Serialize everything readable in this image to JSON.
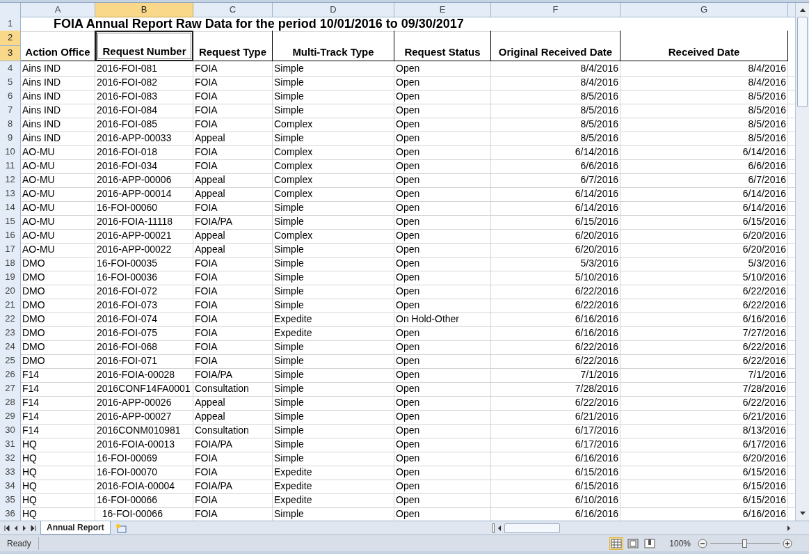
{
  "columns": [
    {
      "label": "A",
      "selected": false
    },
    {
      "label": "B",
      "selected": true
    },
    {
      "label": "C",
      "selected": false
    },
    {
      "label": "D",
      "selected": false
    },
    {
      "label": "E",
      "selected": false
    },
    {
      "label": "F",
      "selected": false
    },
    {
      "label": "G",
      "selected": false
    }
  ],
  "title_row": {
    "row": "1",
    "selected": false,
    "text": "FOIA Annual Report Raw Data for the period 10/01/2016 to 09/30/2017"
  },
  "header_rows": [
    {
      "row": "2",
      "selected": true
    },
    {
      "row": "3",
      "selected": true
    }
  ],
  "headers": [
    {
      "text": "Action Office",
      "selected": false
    },
    {
      "text": "Request Number",
      "selected": true
    },
    {
      "text": "Request Type",
      "selected": false
    },
    {
      "text": "Multi-Track Type",
      "selected": false
    },
    {
      "text": "Request Status",
      "selected": false
    },
    {
      "text": "Original Received Date",
      "selected": false
    },
    {
      "text": "Received Date",
      "selected": false
    }
  ],
  "rows": [
    {
      "row": "4",
      "cells": [
        "Ains IND",
        "2016-FOI-081",
        "FOIA",
        "Simple",
        "Open",
        "8/4/2016",
        "8/4/2016"
      ]
    },
    {
      "row": "5",
      "cells": [
        "Ains IND",
        "2016-FOI-082",
        "FOIA",
        "Simple",
        "Open",
        "8/4/2016",
        "8/4/2016"
      ]
    },
    {
      "row": "6",
      "cells": [
        "Ains IND",
        "2016-FOI-083",
        "FOIA",
        "Simple",
        "Open",
        "8/5/2016",
        "8/5/2016"
      ]
    },
    {
      "row": "7",
      "cells": [
        "Ains IND",
        "2016-FOI-084",
        "FOIA",
        "Simple",
        "Open",
        "8/5/2016",
        "8/5/2016"
      ]
    },
    {
      "row": "8",
      "cells": [
        "Ains IND",
        "2016-FOI-085",
        "FOIA",
        "Complex",
        "Open",
        "8/5/2016",
        "8/5/2016"
      ]
    },
    {
      "row": "9",
      "cells": [
        "Ains IND",
        "2016-APP-00033",
        "Appeal",
        "Simple",
        "Open",
        "8/5/2016",
        "8/5/2016"
      ]
    },
    {
      "row": "10",
      "cells": [
        "AO-MU",
        "2016-FOI-018",
        "FOIA",
        "Complex",
        "Open",
        "6/14/2016",
        "6/14/2016"
      ]
    },
    {
      "row": "11",
      "cells": [
        "AO-MU",
        "2016-FOI-034",
        "FOIA",
        "Complex",
        "Open",
        "6/6/2016",
        "6/6/2016"
      ]
    },
    {
      "row": "12",
      "cells": [
        "AO-MU",
        "2016-APP-00006",
        "Appeal",
        "Complex",
        "Open",
        "6/7/2016",
        "6/7/2016"
      ]
    },
    {
      "row": "13",
      "cells": [
        "AO-MU",
        "2016-APP-00014",
        "Appeal",
        "Complex",
        "Open",
        "6/14/2016",
        "6/14/2016"
      ]
    },
    {
      "row": "14",
      "cells": [
        "AO-MU",
        "16-FOI-00060",
        "FOIA",
        "Simple",
        "Open",
        "6/14/2016",
        "6/14/2016"
      ]
    },
    {
      "row": "15",
      "cells": [
        "AO-MU",
        "2016-FOIA-11118",
        "FOIA/PA",
        "Simple",
        "Open",
        "6/15/2016",
        "6/15/2016"
      ]
    },
    {
      "row": "16",
      "cells": [
        "AO-MU",
        "2016-APP-00021",
        "Appeal",
        "Complex",
        "Open",
        "6/20/2016",
        "6/20/2016"
      ]
    },
    {
      "row": "17",
      "cells": [
        "AO-MU",
        "2016-APP-00022",
        "Appeal",
        "Simple",
        "Open",
        "6/20/2016",
        "6/20/2016"
      ]
    },
    {
      "row": "18",
      "cells": [
        "DMO",
        "16-FOI-00035",
        "FOIA",
        "Simple",
        "Open",
        "5/3/2016",
        "5/3/2016"
      ]
    },
    {
      "row": "19",
      "cells": [
        "DMO",
        "16-FOI-00036",
        "FOIA",
        "Simple",
        "Open",
        "5/10/2016",
        "5/10/2016"
      ]
    },
    {
      "row": "20",
      "cells": [
        "DMO",
        "2016-FOI-072",
        "FOIA",
        "Simple",
        "Open",
        "6/22/2016",
        "6/22/2016"
      ]
    },
    {
      "row": "21",
      "cells": [
        "DMO",
        "2016-FOI-073",
        "FOIA",
        "Simple",
        "Open",
        "6/22/2016",
        "6/22/2016"
      ]
    },
    {
      "row": "22",
      "cells": [
        "DMO",
        "2016-FOI-074",
        "FOIA",
        "Expedite",
        "On Hold-Other",
        "6/16/2016",
        "6/16/2016"
      ]
    },
    {
      "row": "23",
      "cells": [
        "DMO",
        "2016-FOI-075",
        "FOIA",
        "Expedite",
        "Open",
        "6/16/2016",
        "7/27/2016"
      ]
    },
    {
      "row": "24",
      "cells": [
        "DMO",
        "2016-FOI-068",
        "FOIA",
        "Simple",
        "Open",
        "6/22/2016",
        "6/22/2016"
      ]
    },
    {
      "row": "25",
      "cells": [
        "DMO",
        "2016-FOI-071",
        "FOIA",
        "Simple",
        "Open",
        "6/22/2016",
        "6/22/2016"
      ]
    },
    {
      "row": "26",
      "cells": [
        "F14",
        "2016-FOIA-00028",
        "FOIA/PA",
        "Simple",
        "Open",
        "7/1/2016",
        "7/1/2016"
      ]
    },
    {
      "row": "27",
      "cells": [
        "F14",
        "2016CONF14FA0001",
        "Consultation",
        "Simple",
        "Open",
        "7/28/2016",
        "7/28/2016"
      ]
    },
    {
      "row": "28",
      "cells": [
        "F14",
        "2016-APP-00026",
        "Appeal",
        "Simple",
        "Open",
        "6/22/2016",
        "6/22/2016"
      ]
    },
    {
      "row": "29",
      "cells": [
        "F14",
        "2016-APP-00027",
        "Appeal",
        "Simple",
        "Open",
        "6/21/2016",
        "6/21/2016"
      ]
    },
    {
      "row": "30",
      "cells": [
        "F14",
        "2016CONM010981",
        "Consultation",
        "Simple",
        "Open",
        "6/17/2016",
        "8/13/2016"
      ]
    },
    {
      "row": "31",
      "cells": [
        "HQ",
        "2016-FOIA-00013",
        "FOIA/PA",
        "Simple",
        "Open",
        "6/17/2016",
        "6/17/2016"
      ]
    },
    {
      "row": "32",
      "cells": [
        "HQ",
        "16-FOI-00069",
        "FOIA",
        "Simple",
        "Open",
        "6/16/2016",
        "6/20/2016"
      ]
    },
    {
      "row": "33",
      "cells": [
        "HQ",
        "16-FOI-00070",
        "FOIA",
        "Expedite",
        "Open",
        "6/15/2016",
        "6/15/2016"
      ]
    },
    {
      "row": "34",
      "cells": [
        "HQ",
        "2016-FOIA-00004",
        "FOIA/PA",
        "Expedite",
        "Open",
        "6/15/2016",
        "6/15/2016"
      ]
    },
    {
      "row": "35",
      "cells": [
        "HQ",
        "16-FOI-00066",
        "FOIA",
        "Expedite",
        "Open",
        "6/10/2016",
        "6/15/2016"
      ]
    },
    {
      "row": "36",
      "cells": [
        "HQ",
        "  16-FOI-00066",
        "FOIA",
        "Simple",
        "Open",
        "6/16/2016",
        "6/16/2016"
      ]
    }
  ],
  "sheet_tabs": [
    {
      "label": "Annual Report",
      "selected": true
    }
  ],
  "status_bar": {
    "text": "Ready",
    "views": [
      {
        "kind": "normal",
        "selected": true
      },
      {
        "kind": "layout",
        "selected": false
      },
      {
        "kind": "pagebreak",
        "selected": false
      }
    ],
    "zoom": "100%",
    "zoom_slider": {
      "level": 0.5
    }
  }
}
